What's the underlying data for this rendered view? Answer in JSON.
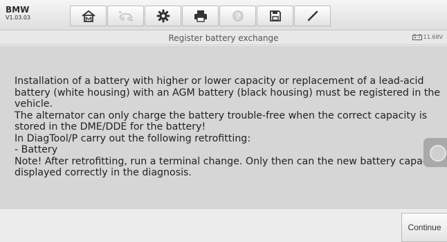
{
  "vehicle": {
    "make": "BMW",
    "version": "V1.03.03"
  },
  "toolbar": {
    "buttons": [
      {
        "icon": "home-icon"
      },
      {
        "icon": "vehicle-swap-icon"
      },
      {
        "icon": "settings-gear-icon"
      },
      {
        "icon": "print-icon"
      },
      {
        "icon": "help-icon"
      },
      {
        "icon": "save-icon"
      },
      {
        "icon": "pen-icon"
      }
    ]
  },
  "header": {
    "title": "Register battery exchange",
    "voltage": "11.68V"
  },
  "main": {
    "lines": [
      "Installation of a battery with higher or lower capacity or replacement of a lead-acid",
      "battery (white housing) with an AGM battery (black housing) must be registered in the",
      "vehicle.",
      "The alternator can only charge the battery trouble-free when the correct capacity is",
      "stored in the DME/DDE for the battery!",
      "In DiagTool/P carry out the following retrofitting:",
      "- Battery",
      "Note! After retrofitting, run a terminal change. Only then can the new battery capacity be",
      "displayed correctly in the diagnosis."
    ]
  },
  "footer": {
    "continue_label": "Continue"
  },
  "colors": {
    "content_bg": "#d6d6d6",
    "text": "#222222"
  }
}
